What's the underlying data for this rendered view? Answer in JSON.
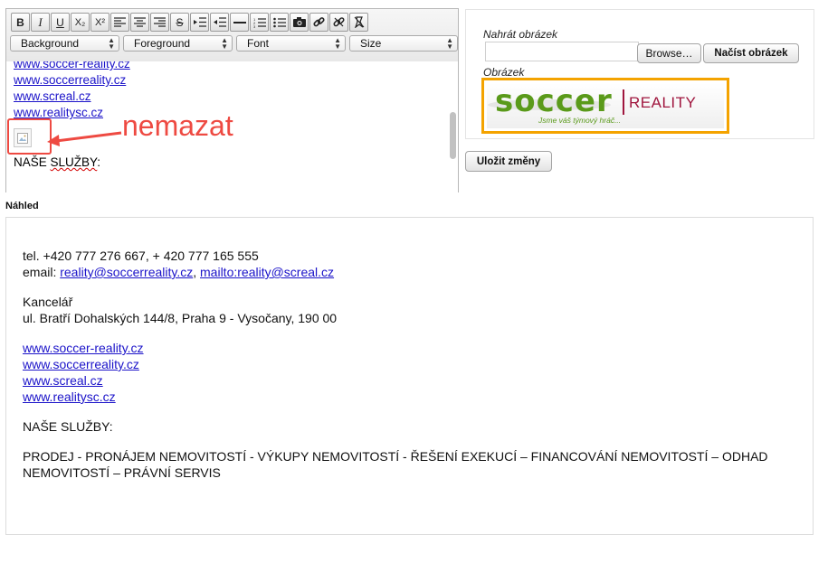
{
  "toolbar": {
    "buttons": [
      {
        "name": "bold-button",
        "label": "B"
      },
      {
        "name": "italic-button",
        "label": "I"
      },
      {
        "name": "underline-button",
        "label": "U"
      },
      {
        "name": "subscript-button",
        "label": "X₂"
      },
      {
        "name": "superscript-button",
        "label": "X²"
      }
    ],
    "selects": {
      "background": "Background",
      "foreground": "Foreground",
      "font": "Font",
      "size": "Size"
    }
  },
  "editor": {
    "links": [
      "www.soccer-reality.cz",
      "www.soccerreality.cz",
      "www.screal.cz",
      "www.realitysc.cz"
    ],
    "sluzby_spell": "SLUŽBY",
    "sluzby_prefix": "NAŠE ",
    "sluzby_suffix": ":"
  },
  "annotation": {
    "label": "nemazat",
    "color": "#ee4a42"
  },
  "upload": {
    "nahrat_label": "Nahrát obrázek",
    "browse_label": "Browse…",
    "load_label": "Načíst obrázek",
    "image_label": "Obrázek",
    "logo_word": "soccer",
    "logo_reality": "REALITY",
    "logo_tagline": "Jsme váš týmový hráč...",
    "logo_green": "#5a9a1a",
    "logo_red": "#a0163e",
    "frame_color": "#f4a300"
  },
  "save_label": "Uložit změny",
  "preview": {
    "heading": "Náhled",
    "tel": "tel. +420 777 276 667, + 420 777 165 555",
    "email_prefix": "email: ",
    "email_1": "reality@soccerreality.cz",
    "email_sep": ", ",
    "email_2": "mailto:reality@screal.cz",
    "office_title": "Kancelář",
    "office_address": "ul. Bratří Dohalských 144/8, Praha 9 - Vysočany, 190 00",
    "links": [
      "www.soccer-reality.cz",
      "www.soccerreality.cz",
      "www.screal.cz",
      "www.realitysc.cz"
    ],
    "services_title": "NAŠE SLUŽBY:",
    "services_line1": "PRODEJ - PRONÁJEM NEMOVITOSTÍ - VÝKUPY NEMOVITOSTÍ - ŘEŠENÍ EXEKUCÍ – FINANCOVÁNÍ NEMOVITOSTÍ – ODHAD",
    "services_line2": "NEMOVITOSTÍ – PRÁVNÍ SERVIS"
  },
  "colors": {
    "link": "#1b13c9",
    "accent_red": "#ee4a42",
    "accent_orange": "#f4a300"
  }
}
